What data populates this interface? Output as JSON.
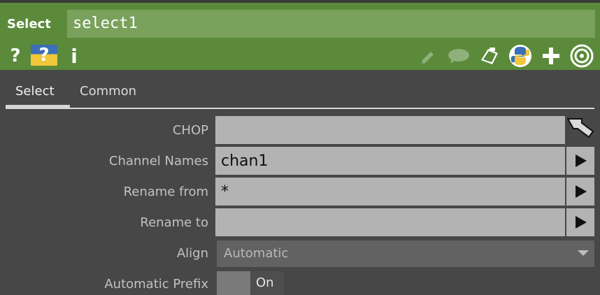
{
  "header": {
    "operator_type": "Select",
    "node_name": "select1",
    "help_icon": "question-icon",
    "python_help_icon": "python-help-icon",
    "info_icon": "info-icon",
    "right_icons": [
      "pencil-icon",
      "comment-icon",
      "clipboard-icon",
      "python-icon",
      "plus-icon",
      "target-icon"
    ]
  },
  "tabs": [
    {
      "label": "Select"
    },
    {
      "label": "Common"
    }
  ],
  "params": {
    "chop": {
      "label": "CHOP",
      "value": ""
    },
    "channel_names": {
      "label": "Channel Names",
      "value": "chan1"
    },
    "rename_from": {
      "label": "Rename from",
      "value": "*"
    },
    "rename_to": {
      "label": "Rename to",
      "value": ""
    },
    "align": {
      "label": "Align",
      "value": "Automatic"
    },
    "automatic_prefix": {
      "label": "Automatic Prefix",
      "value": "On"
    }
  }
}
